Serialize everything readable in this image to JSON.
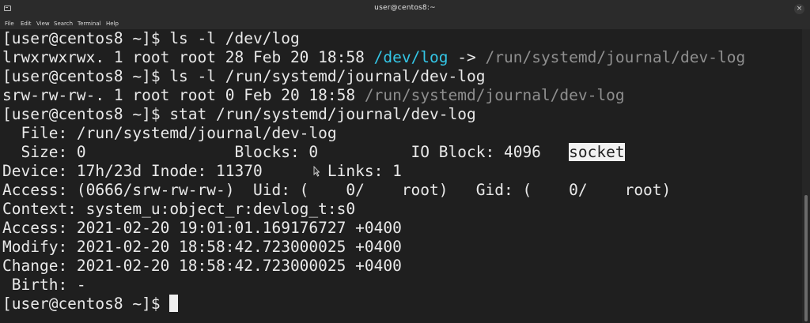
{
  "window": {
    "title": "user@centos8:~",
    "close_glyph": "×"
  },
  "menu": [
    "File",
    "Edit",
    "View",
    "Search",
    "Terminal",
    "Help"
  ],
  "terminal": {
    "lines": [
      "[user@centos8 ~]$ ls -l /dev/log",
      "lrwxrwxrwx. 1 root root 28 Feb 20 18:58 ",
      "/dev/log",
      " -> ",
      "/run/systemd/journal/dev-log",
      "[user@centos8 ~]$ ls -l /run/systemd/journal/dev-log",
      "srw-rw-rw-. 1 root root 0 Feb 20 18:58 ",
      "/run/systemd/journal/dev-log",
      "[user@centos8 ~]$ stat /run/systemd/journal/dev-log",
      "  File: /run/systemd/journal/dev-log",
      "  Size: 0                Blocks: 0          IO Block: 4096   ",
      "socket",
      "Device: 17h/23d Inode: 11370       Links: 1",
      "Access: (0666/srw-rw-rw-)  Uid: (    0/    root)   Gid: (    0/    root)",
      "Context: system_u:object_r:devlog_t:s0",
      "Access: 2021-02-20 19:01:01.169176727 +0400",
      "Modify: 2021-02-20 18:58:42.723000025 +0400",
      "Change: 2021-02-20 18:58:42.723000025 +0400",
      " Birth: -",
      "[user@centos8 ~]$ "
    ]
  },
  "colors": {
    "background": "#1f1f1f",
    "text": "#e9e9e9",
    "link": "#34c6e6",
    "dim": "#8f8f8f"
  }
}
